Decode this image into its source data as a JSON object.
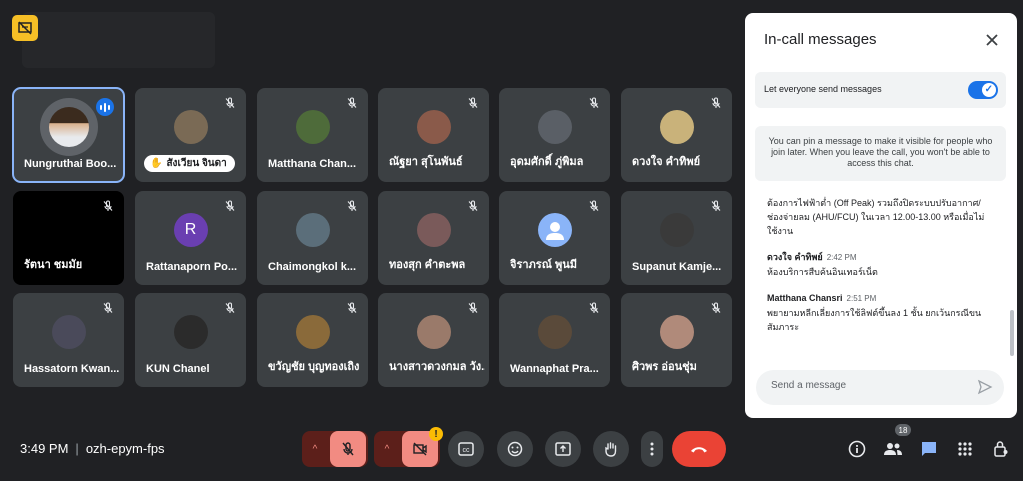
{
  "tiles": [
    {
      "name": "Nungruthai Boo...",
      "active": true,
      "speaking": true
    },
    {
      "name": "สังเวียน จินดา",
      "pill": true
    },
    {
      "name": "Matthana Chan..."
    },
    {
      "name": "ณัฐยา สุโนพันธ์"
    },
    {
      "name": "อุดมศักดิ์ ภู่พิมล"
    },
    {
      "name": "ดวงใจ คำทิพย์"
    },
    {
      "name": "รัตนา ชมมัย",
      "dark": true
    },
    {
      "name": "Rattanaporn Po...",
      "letter": "R"
    },
    {
      "name": "Chaimongkol k..."
    },
    {
      "name": "ทองสุก คำตะพล"
    },
    {
      "name": "จิราภรณ์ พูนมี",
      "default_avatar": true
    },
    {
      "name": "Supanut Kamje..."
    },
    {
      "name": "Hassatorn Kwan..."
    },
    {
      "name": "KUN Chanel"
    },
    {
      "name": "ขวัญชัย บุญทองเถิง"
    },
    {
      "name": "นางสาวดวงกมล วัง..."
    },
    {
      "name": "Wannaphat Pra..."
    },
    {
      "name": "ศิวพร อ่อนชุ่ม"
    }
  ],
  "panel": {
    "title": "In-call messages",
    "setting_label": "Let everyone send messages",
    "pin_note": "You can pin a message to make it visible for people who join later. When you leave the call, you won't be able to access this chat.",
    "messages": [
      {
        "sender": "",
        "time": "",
        "text": "ต้องการไฟฟ้าต่ำ (Off Peak) รวมถึงปิดระบบปรับอากาศ/ช่องจ่ายลม (AHU/FCU) ในเวลา 12.00-13.00 หรือเมื่อไม่ใช้งาน"
      },
      {
        "sender": "ดวงใจ คำทิพย์",
        "time": "2:42 PM",
        "text": "ห้องบริการสืบค้นอินเทอร์เน็ต"
      },
      {
        "sender": "Matthana Chansri",
        "time": "2:51 PM",
        "text": "พยายามหลีกเลี่ยงการใช้ลิฟต์ขึ้นลง 1 ชั้น ยกเว้นกรณีขนสัมภาระ"
      }
    ],
    "input_placeholder": "Send a message"
  },
  "bottom": {
    "time": "3:49 PM",
    "meeting_code": "ozh-epym-fps",
    "warning_badge": "!",
    "people_count": "18"
  },
  "colors": {
    "accent": "#1a73e8",
    "hangup": "#ea4335",
    "mic_off": "#f28b82",
    "warn": "#fbbc04"
  }
}
